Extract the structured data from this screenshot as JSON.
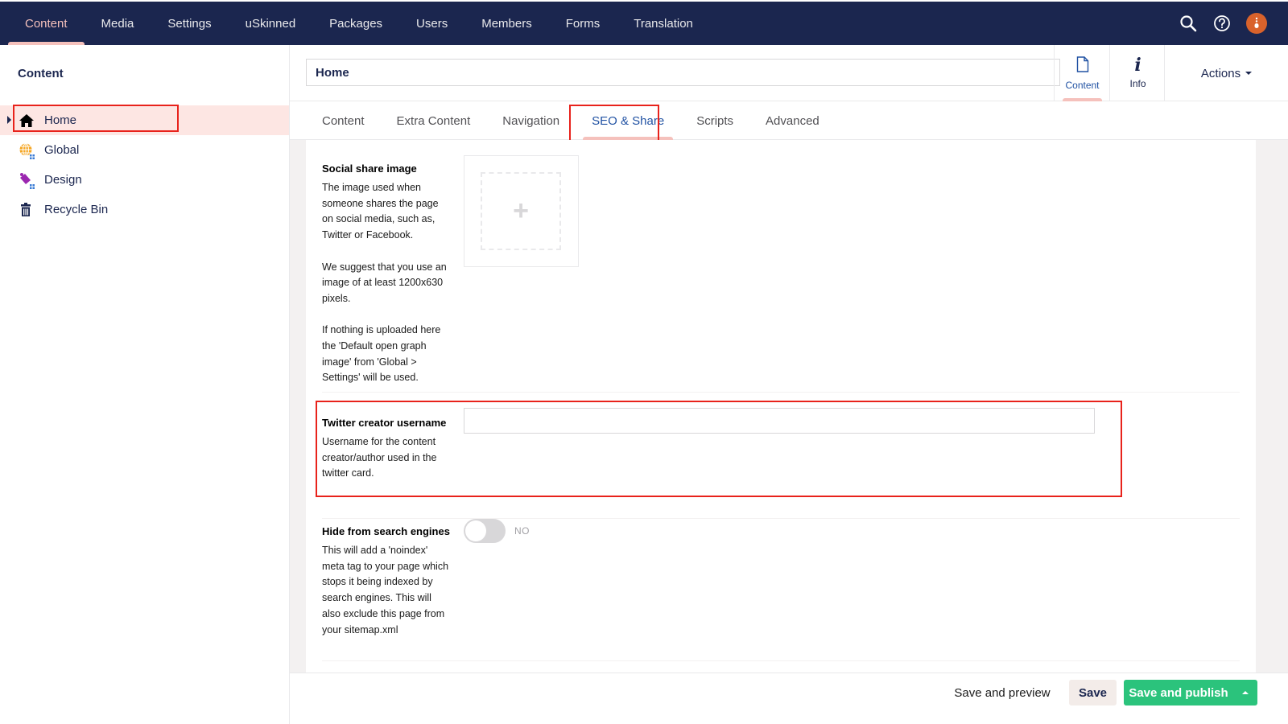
{
  "topnav": {
    "items": [
      {
        "label": "Content",
        "active": true
      },
      {
        "label": "Media"
      },
      {
        "label": "Settings"
      },
      {
        "label": "uSkinned"
      },
      {
        "label": "Packages"
      },
      {
        "label": "Users"
      },
      {
        "label": "Members"
      },
      {
        "label": "Forms"
      },
      {
        "label": "Translation"
      }
    ],
    "icons": [
      "search-icon",
      "help-icon",
      "user-avatar"
    ]
  },
  "sidebar": {
    "title": "Content",
    "items": [
      {
        "label": "Home",
        "icon": "home-icon",
        "selected": true
      },
      {
        "label": "Global",
        "icon": "globe-icon"
      },
      {
        "label": "Design",
        "icon": "paint-bucket-icon"
      },
      {
        "label": "Recycle Bin",
        "icon": "trash-icon"
      }
    ]
  },
  "editor": {
    "node_name": "Home",
    "apps": [
      {
        "label": "Content",
        "icon": "document-icon",
        "active": true
      },
      {
        "label": "Info",
        "icon": "info-icon"
      }
    ],
    "actions_label": "Actions",
    "tabs": [
      {
        "label": "Content"
      },
      {
        "label": "Extra Content"
      },
      {
        "label": "Navigation"
      },
      {
        "label": "SEO & Share",
        "active": true
      },
      {
        "label": "Scripts"
      },
      {
        "label": "Advanced"
      }
    ],
    "properties": [
      {
        "label": "Social share image",
        "description": [
          "The image used when someone shares the page on social media, such as, Twitter or Facebook.",
          "We suggest that you use an image of at least 1200x630 pixels.",
          "If nothing is uploaded here the 'Default open graph image' from 'Global > Settings' will be used."
        ],
        "editor": "image-picker",
        "add_glyph": "+"
      },
      {
        "label": "Twitter creator username",
        "description": [
          "Username for the content creator/author used in the twitter card."
        ],
        "editor": "textbox",
        "value": ""
      },
      {
        "label": "Hide from search engines",
        "description": [
          "This will add a 'noindex' meta tag to your page which stops it being indexed by search engines. This will also exclude this page from your sitemap.xml"
        ],
        "editor": "toggle",
        "toggle_state": "NO"
      }
    ]
  },
  "footer": {
    "save_preview": "Save and preview",
    "save": "Save",
    "save_publish": "Save and publish"
  },
  "colors": {
    "header_bg": "#1b264f",
    "accent_pink": "#f5c1bc",
    "active_blue": "#2152a3",
    "publish_green": "#2bc37c",
    "highlight_red": "#e8221b",
    "avatar_orange": "#d9622b"
  }
}
